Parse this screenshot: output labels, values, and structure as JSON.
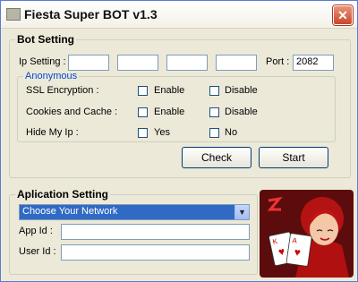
{
  "window": {
    "title": "Fiesta Super BOT v1.3",
    "close_glyph": "✕"
  },
  "bot_setting": {
    "legend": "Bot Setting",
    "ip_label": "Ip Setting :",
    "ip_octets": [
      "",
      "",
      "",
      ""
    ],
    "port_label": "Port :",
    "port_value": "2082",
    "anonymous": {
      "legend": "Anonymous",
      "rows": [
        {
          "label": "SSL Encryption :",
          "opt1": "Enable",
          "opt2": "Disable"
        },
        {
          "label": "Cookies and Cache :",
          "opt1": "Enable",
          "opt2": "Disable"
        },
        {
          "label": "Hide My Ip :",
          "opt1": "Yes",
          "opt2": "No"
        }
      ]
    },
    "check_button": "Check",
    "start_button": "Start"
  },
  "app_setting": {
    "legend": "Aplication Setting",
    "network_selected": "Choose Your Network",
    "app_id_label": "App Id :",
    "app_id_value": "",
    "user_id_label": "User Id :",
    "user_id_value": ""
  },
  "colors": {
    "window_bg": "#ece9d8",
    "selection": "#316ac5",
    "close": "#c9482b"
  }
}
